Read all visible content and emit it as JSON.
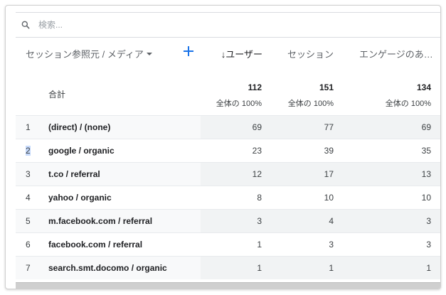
{
  "search": {
    "placeholder": "検索..."
  },
  "table": {
    "dimension_header": "セッション参照元 / メディア",
    "columns": {
      "users": "↓ユーザー",
      "sessions": "セッション",
      "engagement": "エンゲージのあ…"
    },
    "total": {
      "label": "合計",
      "users": "112",
      "sessions": "151",
      "engagement": "134",
      "users_pct": "全体の 100%",
      "sessions_pct": "全体の 100%",
      "engagement_pct": "全体の 100%"
    },
    "rows": [
      {
        "num": "1",
        "label": "(direct) / (none)",
        "users": "69",
        "sessions": "77",
        "engagement": "69"
      },
      {
        "num": "2",
        "label": "google / organic",
        "users": "23",
        "sessions": "39",
        "engagement": "35"
      },
      {
        "num": "3",
        "label": "t.co / referral",
        "users": "12",
        "sessions": "17",
        "engagement": "13"
      },
      {
        "num": "4",
        "label": "yahoo / organic",
        "users": "8",
        "sessions": "10",
        "engagement": "10"
      },
      {
        "num": "5",
        "label": "m.facebook.com / referral",
        "users": "3",
        "sessions": "4",
        "engagement": "3"
      },
      {
        "num": "6",
        "label": "facebook.com / referral",
        "users": "1",
        "sessions": "3",
        "engagement": "3"
      },
      {
        "num": "7",
        "label": "search.smt.docomo / organic",
        "users": "1",
        "sessions": "1",
        "engagement": "1"
      }
    ]
  },
  "colors": {
    "accent": "#1a73e8",
    "row_shade": "#f8f9fa",
    "selection": "#c6dafc"
  },
  "icons": {
    "search": "search-icon",
    "add": "plus-icon",
    "dropdown": "caret-down-icon"
  }
}
